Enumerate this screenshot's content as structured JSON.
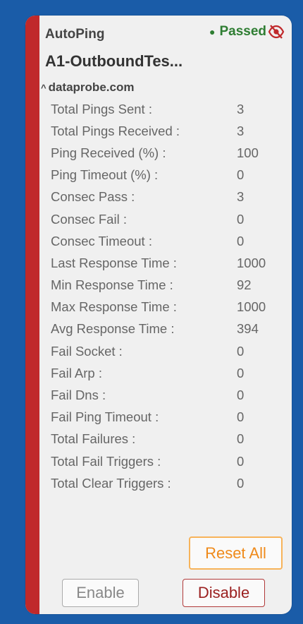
{
  "card": {
    "type": "AutoPing",
    "status": "Passed",
    "status_color": "#2e7d32",
    "name": "A1-OutboundTes...",
    "host": "dataprobe.com",
    "stripe_color": "#c0292b"
  },
  "stats": [
    {
      "label": "Total Pings Sent :",
      "value": "3"
    },
    {
      "label": "Total Pings Received :",
      "value": "3"
    },
    {
      "label": "Ping Received (%) :",
      "value": "100"
    },
    {
      "label": "Ping Timeout (%) :",
      "value": "0"
    },
    {
      "label": "Consec Pass :",
      "value": "3"
    },
    {
      "label": "Consec Fail :",
      "value": "0"
    },
    {
      "label": "Consec Timeout :",
      "value": "0"
    },
    {
      "label": "Last Response Time :",
      "value": "1000"
    },
    {
      "label": "Min Response Time :",
      "value": "92"
    },
    {
      "label": "Max Response Time :",
      "value": "1000"
    },
    {
      "label": "Avg Response Time :",
      "value": "394"
    },
    {
      "label": "Fail Socket :",
      "value": "0"
    },
    {
      "label": "Fail Arp :",
      "value": "0"
    },
    {
      "label": "Fail Dns :",
      "value": "0"
    },
    {
      "label": "Fail Ping Timeout :",
      "value": "0"
    },
    {
      "label": "Total Failures :",
      "value": "0"
    },
    {
      "label": "Total Fail Triggers :",
      "value": "0"
    },
    {
      "label": "Total Clear Triggers :",
      "value": "0"
    }
  ],
  "buttons": {
    "reset_all": "Reset All",
    "enable": "Enable",
    "disable": "Disable"
  },
  "icons": {
    "status_dot": "status-dot-icon",
    "visibility_off": "eye-off-icon",
    "collapse": "caret-up-icon"
  }
}
